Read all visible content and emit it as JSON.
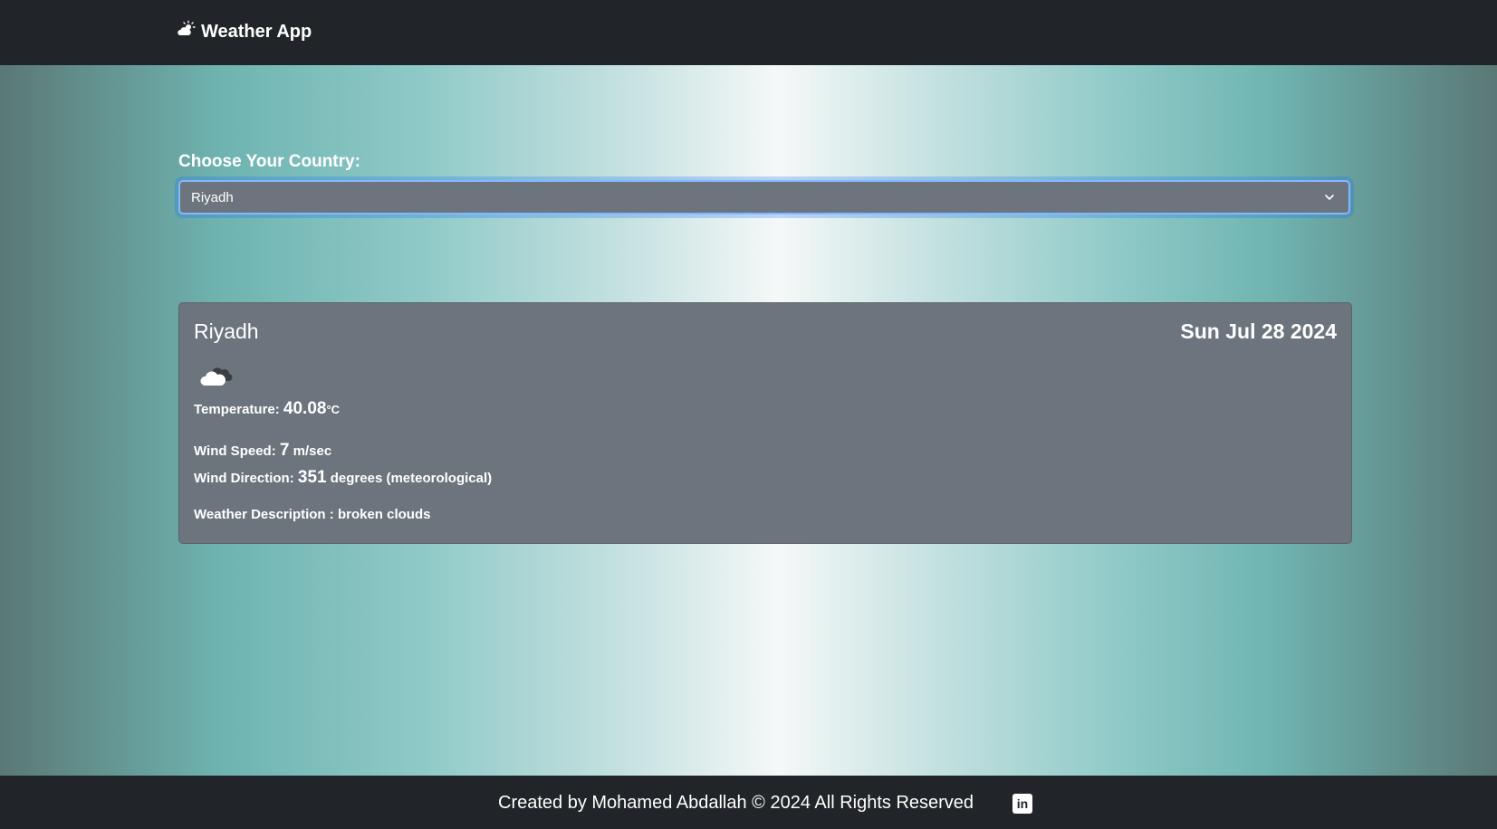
{
  "navbar": {
    "brand_icon": "sun-cloud-icon",
    "brand_text": "Weather App"
  },
  "selector": {
    "label": "Choose Your Country:",
    "selected_value": "Riyadh",
    "chevron_icon": "chevron-down-icon"
  },
  "weather": {
    "city": "Riyadh",
    "date": "Sun Jul 28 2024",
    "icon": "broken-clouds-icon",
    "temperature_label": "Temperature:",
    "temperature_value": "40.08",
    "temperature_unit": "°C",
    "wind_speed_label": "Wind Speed:",
    "wind_speed_value": "7",
    "wind_speed_unit": "m/sec",
    "wind_direction_label": "Wind Direction:",
    "wind_direction_value": "351",
    "wind_direction_unit": "degrees (meteorological)",
    "description_label": "Weather Description :",
    "description_value": "broken clouds"
  },
  "footer": {
    "text": "Created by Mohamed Abdallah © 2024 All Rights Reserved",
    "social_icon": "linkedin-icon",
    "social_glyph": "in"
  },
  "colors": {
    "nav_bg": "#212529",
    "card_bg": "#6c757d",
    "focus_border": "#86b7fe"
  }
}
